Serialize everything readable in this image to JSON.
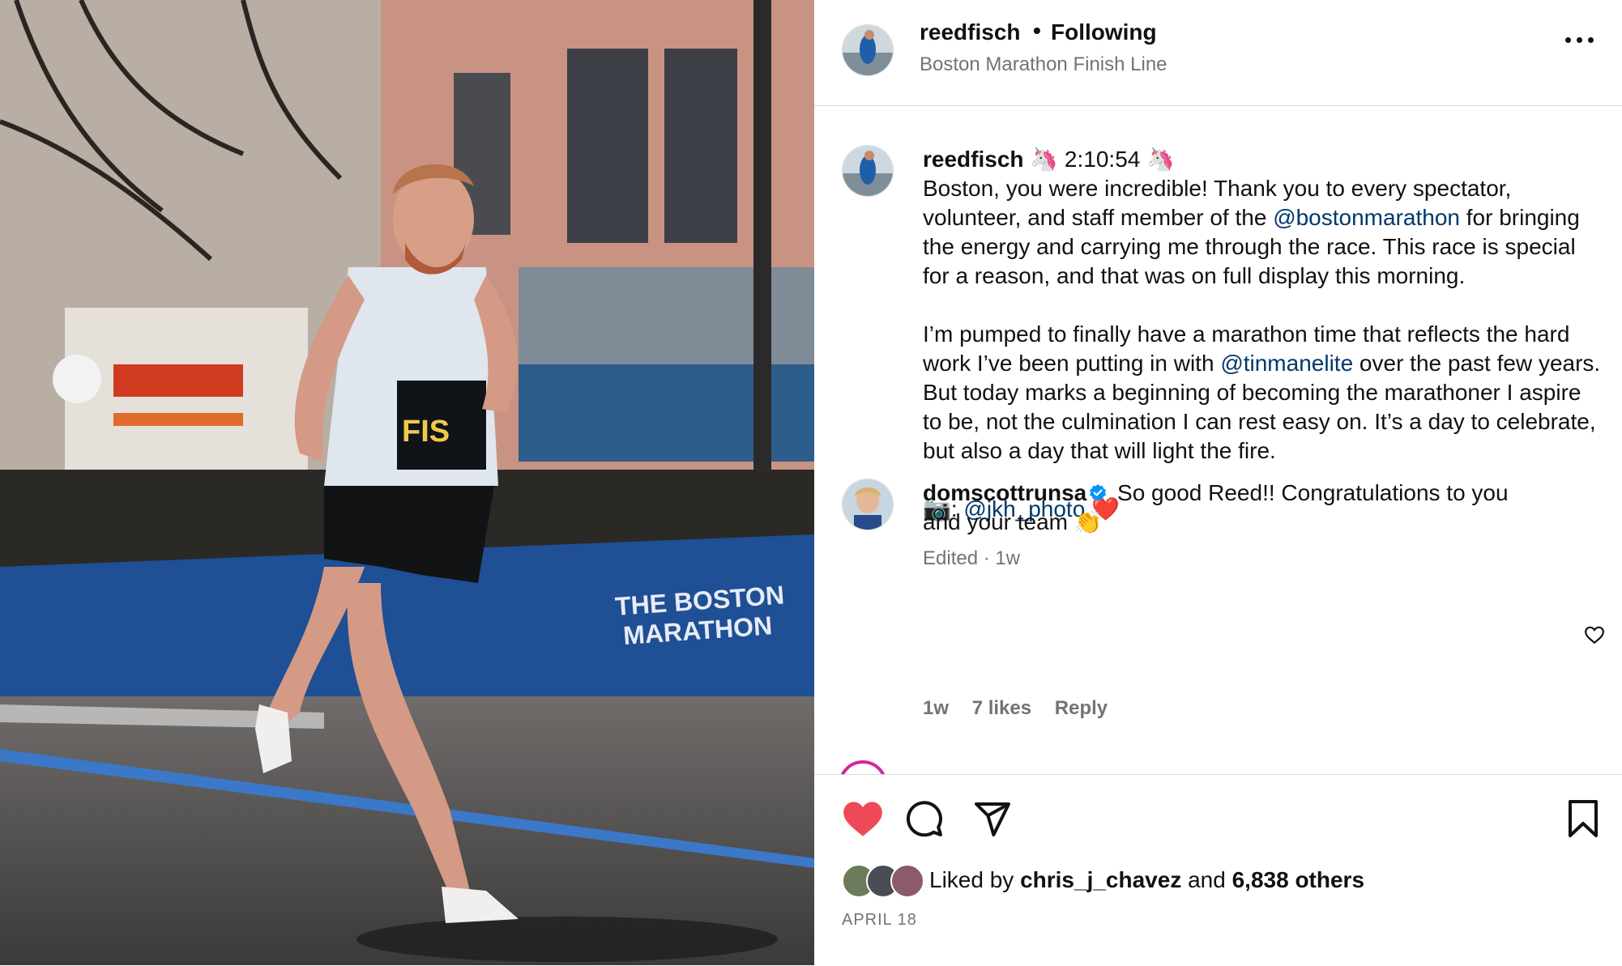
{
  "header": {
    "username": "reedfisch",
    "separator": "•",
    "follow_status": "Following",
    "location": "Boston Marathon Finish Line"
  },
  "caption": {
    "username": "reedfisch",
    "title": "🦄 2:10:54 🦄",
    "p1_a": "Boston, you were incredible! Thank you to every spectator, volunteer, and staff member of the ",
    "p1_link": "@bostonmarathon",
    "p1_b": " for bringing the energy and carrying me through the race. This race is special for a reason, and that was on full display this morning.",
    "p2_a": "I’m pumped to finally have a marathon time that reflects the hard work I’ve been putting in with ",
    "p2_link": "@tinmanelite",
    "p2_b": " over the past few years. But today marks a beginning of becoming the marathoner I aspire to be, not the culmination I can rest easy on. It’s a day to celebrate, but also a day that will light the fire.",
    "p3_a": "📷: ",
    "p3_link": "@jkh_photo",
    "p3_b": " ❤️",
    "edited": "Edited · 1w"
  },
  "comment": {
    "username": "domscottrunsa",
    "text": "So good Reed!! Congratulations to you and your team 👏",
    "time": "1w",
    "likes": "7 likes",
    "reply": "Reply"
  },
  "likes": {
    "prefix": "Liked by ",
    "user": "chris_j_chavez",
    "middle": " and ",
    "count": "6,838 others"
  },
  "post_date": "APRIL 18",
  "colors": {
    "like_red": "#ed4956",
    "link_blue": "#00376b",
    "verified_blue": "#0095f6",
    "muted": "#737373"
  },
  "icons": [
    "more-icon",
    "heart-icon",
    "comment-icon",
    "share-icon",
    "bookmark-icon",
    "verified-icon"
  ]
}
